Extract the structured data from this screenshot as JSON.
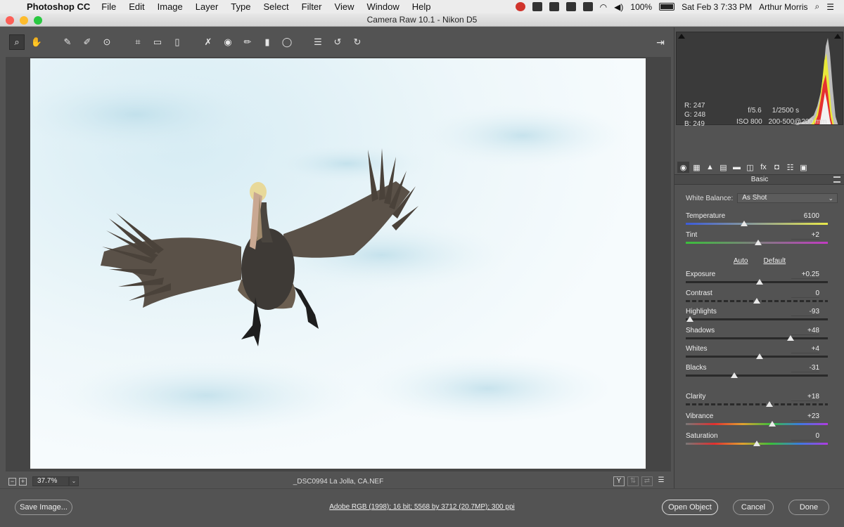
{
  "menubar": {
    "app_name": "Photoshop CC",
    "menus": [
      "File",
      "Edit",
      "Image",
      "Layer",
      "Type",
      "Select",
      "Filter",
      "View",
      "Window",
      "Help"
    ],
    "battery": "100%",
    "datetime": "Sat Feb 3  7:33 PM",
    "user": "Arthur Morris",
    "status_icons": [
      "adobe-cc-icon",
      "wifi-icon",
      "volume-icon",
      "battery-icon",
      "search-icon",
      "list-icon"
    ]
  },
  "window": {
    "title": "Camera Raw 10.1  -  Nikon D5"
  },
  "toolbar": {
    "tools": [
      {
        "name": "zoom-tool-icon",
        "glyph": "⌕",
        "active": true
      },
      {
        "name": "hand-tool-icon",
        "glyph": "✋",
        "active": false
      },
      {
        "name": "white-balance-tool-icon",
        "glyph": "✎",
        "active": false
      },
      {
        "name": "color-sampler-tool-icon",
        "glyph": "✐",
        "active": false
      },
      {
        "name": "targeted-adjustment-tool-icon",
        "glyph": "⊙",
        "active": false
      },
      {
        "name": "crop-tool-icon",
        "glyph": "⌗",
        "active": false
      },
      {
        "name": "straighten-tool-icon",
        "glyph": "▭",
        "active": false
      },
      {
        "name": "transform-tool-icon",
        "glyph": "▯",
        "active": false
      },
      {
        "name": "spot-removal-tool-icon",
        "glyph": "✗",
        "active": false
      },
      {
        "name": "red-eye-tool-icon",
        "glyph": "◉",
        "active": false
      },
      {
        "name": "adjustment-brush-icon",
        "glyph": "✏",
        "active": false
      },
      {
        "name": "graduated-filter-icon",
        "glyph": "▮",
        "active": false
      },
      {
        "name": "radial-filter-icon",
        "glyph": "◯",
        "active": false
      },
      {
        "name": "preferences-icon",
        "glyph": "☰",
        "active": false
      },
      {
        "name": "rotate-left-icon",
        "glyph": "↺",
        "active": false
      },
      {
        "name": "rotate-right-icon",
        "glyph": "↻",
        "active": false
      }
    ],
    "fullscreen_glyph": "⇥"
  },
  "canvas": {
    "zoom": "37.7%",
    "filename": "_DSC0994  La  Jolla, CA.NEF",
    "view_button": "Y"
  },
  "readout": {
    "r": "R:  247",
    "g": "G:  248",
    "b": "B:  249",
    "aperture": "f/5.6",
    "shutter": "1/2500 s",
    "iso": "ISO 800",
    "lens": "200-500@200 mm"
  },
  "panel": {
    "section": "Basic",
    "white_balance_label": "White Balance:",
    "white_balance_value": "As Shot",
    "auto": "Auto",
    "default": "Default",
    "sliders": [
      {
        "id": "temperature",
        "label": "Temperature",
        "value": "6100",
        "position": 0.41,
        "track": "temperature"
      },
      {
        "id": "tint",
        "label": "Tint",
        "value": "+2",
        "position": 0.51,
        "track": "tint"
      },
      {
        "id": "exposure",
        "label": "Exposure",
        "value": "+0.25",
        "position": 0.52,
        "track": "plain"
      },
      {
        "id": "contrast",
        "label": "Contrast",
        "value": "0",
        "position": 0.5,
        "track": "dash"
      },
      {
        "id": "highlights",
        "label": "Highlights",
        "value": "-93",
        "position": 0.03,
        "track": "plain"
      },
      {
        "id": "shadows",
        "label": "Shadows",
        "value": "+48",
        "position": 0.74,
        "track": "plain"
      },
      {
        "id": "whites",
        "label": "Whites",
        "value": "+4",
        "position": 0.52,
        "track": "plain"
      },
      {
        "id": "blacks",
        "label": "Blacks",
        "value": "-31",
        "position": 0.34,
        "track": "plain"
      },
      {
        "id": "clarity",
        "label": "Clarity",
        "value": "+18",
        "position": 0.59,
        "track": "dash"
      },
      {
        "id": "vibrance",
        "label": "Vibrance",
        "value": "+23",
        "position": 0.61,
        "track": "vibrance"
      },
      {
        "id": "saturation",
        "label": "Saturation",
        "value": "0",
        "position": 0.5,
        "track": "saturation"
      }
    ],
    "tabs": [
      {
        "name": "basic-tab-icon",
        "glyph": "◉",
        "active": true
      },
      {
        "name": "tone-curve-tab-icon",
        "glyph": "▦",
        "active": false
      },
      {
        "name": "detail-tab-icon",
        "glyph": "▲",
        "active": false
      },
      {
        "name": "hsl-tab-icon",
        "glyph": "▤",
        "active": false
      },
      {
        "name": "split-toning-tab-icon",
        "glyph": "▬",
        "active": false
      },
      {
        "name": "lens-corrections-tab-icon",
        "glyph": "◫",
        "active": false
      },
      {
        "name": "effects-tab-icon",
        "glyph": "fx",
        "active": false
      },
      {
        "name": "camera-calibration-tab-icon",
        "glyph": "◘",
        "active": false
      },
      {
        "name": "presets-tab-icon",
        "glyph": "☷",
        "active": false
      },
      {
        "name": "snapshots-tab-icon",
        "glyph": "▣",
        "active": false
      }
    ]
  },
  "bottom": {
    "save_image": "Save Image...",
    "workflow": "Adobe RGB (1998); 16 bit; 5568 by 3712 (20.7MP); 300 ppi",
    "open_object": "Open Object",
    "cancel": "Cancel",
    "done": "Done"
  },
  "colors": {
    "panel_bg": "#535353",
    "canvas_bg": "#454545",
    "histogram_bg": "#3a3a3a"
  }
}
